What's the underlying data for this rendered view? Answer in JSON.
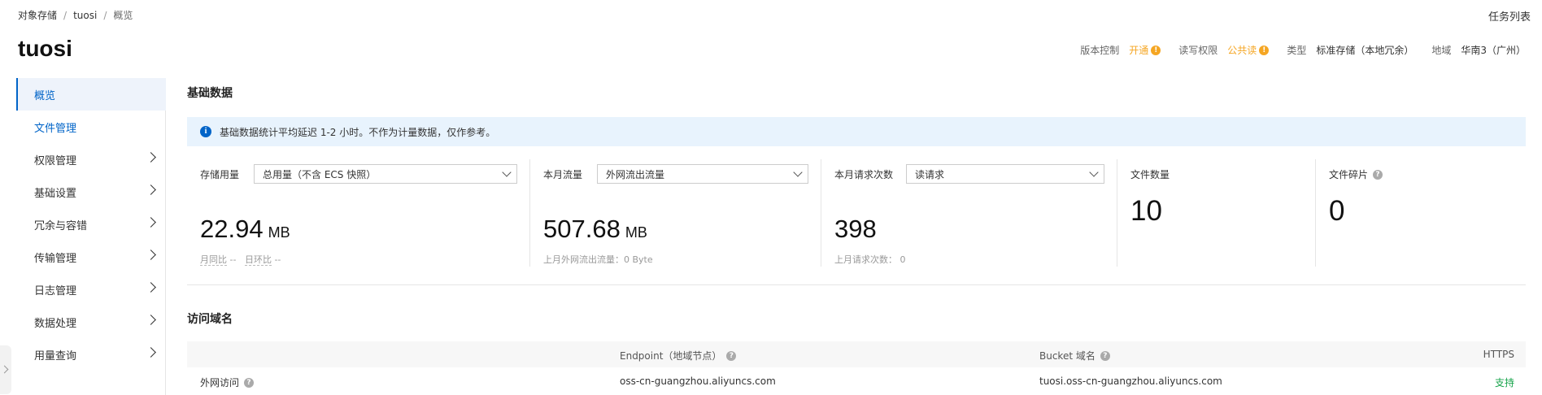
{
  "breadcrumb": {
    "root": "对象存储",
    "sep1": "/",
    "bucket": "tuosi",
    "sep2": "/",
    "current": "概览"
  },
  "top": {
    "task_list": "任务列表"
  },
  "title": "tuosi",
  "meta": {
    "version_label": "版本控制",
    "version_value": "开通",
    "acl_label": "读写权限",
    "acl_value": "公共读",
    "type_label": "类型",
    "type_value": "标准存储（本地冗余）",
    "region_label": "地域",
    "region_value": "华南3（广州）"
  },
  "sidebar": {
    "items": [
      {
        "label": "概览"
      },
      {
        "label": "文件管理"
      },
      {
        "label": "权限管理"
      },
      {
        "label": "基础设置"
      },
      {
        "label": "冗余与容错"
      },
      {
        "label": "传输管理"
      },
      {
        "label": "日志管理"
      },
      {
        "label": "数据处理"
      },
      {
        "label": "用量查询"
      }
    ]
  },
  "basic": {
    "title": "基础数据",
    "notice": "基础数据统计平均延迟 1-2 小时。不作为计量数据，仅作参考。"
  },
  "cards": {
    "storage": {
      "label": "存储用量",
      "select": "总用量（不含 ECS 快照）",
      "value": "22.94",
      "unit": "MB",
      "yoy_label": "月同比",
      "yoy_value": "--",
      "mom_label": "日环比",
      "mom_value": "--"
    },
    "traffic": {
      "label": "本月流量",
      "select": "外网流出流量",
      "value": "507.68",
      "unit": "MB",
      "sub": "上月外网流出流量：0 Byte"
    },
    "requests": {
      "label": "本月请求次数",
      "select": "读请求",
      "value": "398",
      "sub": "上月请求次数：  0"
    },
    "files": {
      "label": "文件数量",
      "value": "10"
    },
    "fragments": {
      "label": "文件碎片",
      "value": "0"
    }
  },
  "domains": {
    "title": "访问域名",
    "headers": {
      "endpoint": "Endpoint（地域节点）",
      "bucket": "Bucket 域名",
      "https": "HTTPS"
    },
    "rows": [
      {
        "name": "外网访问",
        "endpoint": "oss-cn-guangzhou.aliyuncs.com",
        "bucket": "tuosi.oss-cn-guangzhou.aliyuncs.com",
        "https": "支持"
      }
    ]
  }
}
